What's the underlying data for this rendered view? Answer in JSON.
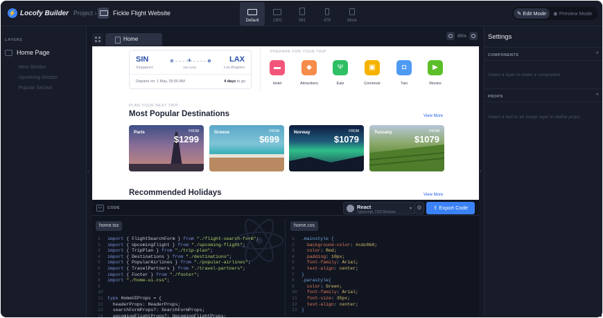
{
  "app": {
    "name": "Locofy Builder",
    "project_label": "Project",
    "project_name": "Fickle Flight Website"
  },
  "devices": [
    {
      "label": "Default",
      "active": true
    },
    {
      "label": "1300",
      "active": false
    },
    {
      "label": "991",
      "active": false
    },
    {
      "label": "479",
      "active": false
    },
    {
      "label": "More",
      "active": false
    }
  ],
  "modes": {
    "edit": "Edit Mode",
    "preview": "Preview Mode"
  },
  "layers": {
    "title": "LAYERS",
    "page": "Home Page",
    "items": [
      "Hero Section",
      "Upcoming Section",
      "Popular Section"
    ]
  },
  "canvas": {
    "tab": "Home",
    "zoom": "95%"
  },
  "preview": {
    "flight": {
      "from_code": "SIN",
      "from_city": "Singapore",
      "to_code": "LAX",
      "to_city": "Los Angeles",
      "duration": "15H 5AM",
      "departs": "Departs on: 1 May, 05:00 AM",
      "days": "4 days",
      "days_suffix": "to go"
    },
    "prepare": "PREPARE FOR YOUR TRIP",
    "categories": [
      {
        "label": "Hotel",
        "color": "#f3557a",
        "icon": "hotel-icon"
      },
      {
        "label": "Attractions",
        "color": "#f68c4a",
        "icon": "ticket-icon"
      },
      {
        "label": "Eats",
        "color": "#2fbf64",
        "icon": "utensils-icon"
      },
      {
        "label": "Commute",
        "color": "#f6b300",
        "icon": "train-icon"
      },
      {
        "label": "Taxi",
        "color": "#4f9bf4",
        "icon": "car-icon"
      },
      {
        "label": "Movies",
        "color": "#5cbf2a",
        "icon": "film-icon"
      }
    ],
    "plan": "PLAN YOUR NEXT TRIP",
    "popular": "Most Popular Destinations",
    "view_more": "View More",
    "from": "FROM",
    "destinations": [
      {
        "name": "Paris",
        "price": "$1299"
      },
      {
        "name": "Greece",
        "price": "$699"
      },
      {
        "name": "Norway",
        "price": "$1079"
      },
      {
        "name": "Tuscany",
        "price": "$1079"
      }
    ],
    "recommended": "Recommended Holidays"
  },
  "code": {
    "title": "CODE",
    "framework": "React",
    "framework_sub": "Typescript, CSS Modules",
    "export": "Export Code",
    "tsx_file": "home.tsx",
    "css_file": "home.css",
    "tsx_lines": [
      "import { FlightSearchForm } from \"./flight-search-form\";",
      "import { UpcomingFlight } from \"./upcoming-flight\";",
      "import { TripPlan } from \"./trip-plan\";",
      "import { Destinations } from \"./destinations\";",
      "import { PopularAirlines } from \"./popular-airlines\";",
      "import { TravelPartners } from \"./travel-partners\";",
      "import { Footer } from \"./footer\";",
      "import \"./home-ui.css\";",
      "",
      "",
      "type HomeUIProps = {",
      "  headerProps: HeaderProps;",
      "  searchFormProps?: SearchFormProps;",
      "  upcomingFlightProps?: UpcomingFlightProps;"
    ],
    "css_lines": [
      ".mainstyle {",
      "  background-color: #cdc0b0;",
      "  color: Red;",
      "  padding: 10px;",
      "  font-family: Arial;",
      "  text-align: center;",
      "}",
      ".parastyle{",
      "  color: Green;",
      "  font-family: Arial;",
      "  font-size: 35px;",
      "  text-align: center;",
      "}"
    ]
  },
  "settings": {
    "title": "Settings",
    "components": "COMPONENTS",
    "components_hint": "Select a layer to make a component.",
    "props": "PROPS",
    "props_hint": "Select a text or an image layer to define props."
  }
}
